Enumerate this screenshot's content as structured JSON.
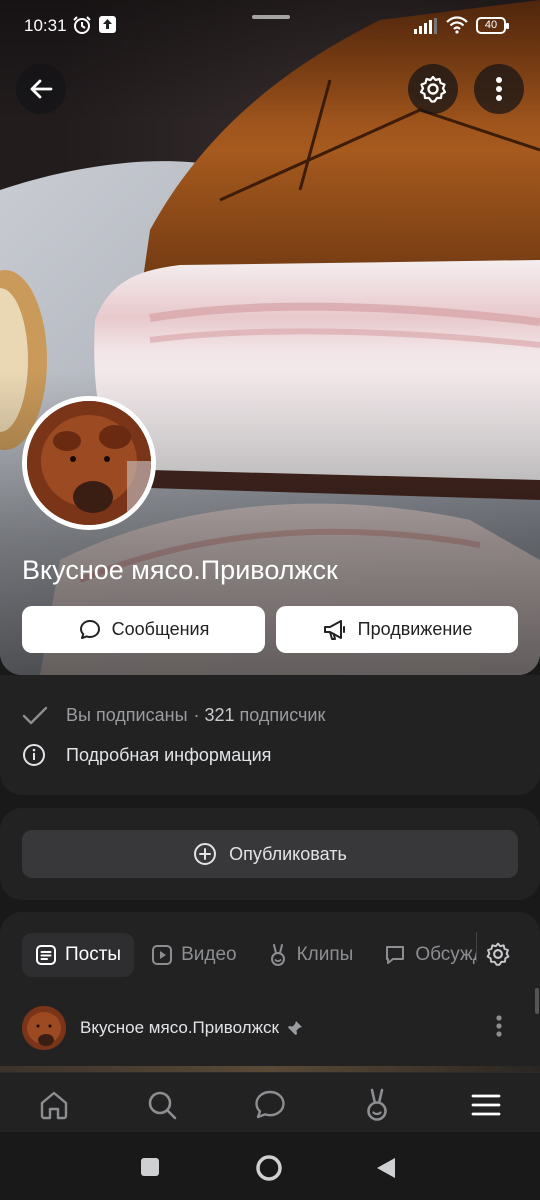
{
  "status_bar": {
    "time": "10:31",
    "battery": "40"
  },
  "group": {
    "name": "Вкусное мясо.Приволжск"
  },
  "cover_actions": {
    "messages_label": "Сообщения",
    "promotion_label": "Продвижение"
  },
  "info": {
    "subscribed_text": "Вы подписаны",
    "separator": "·",
    "subscriber_count": "321",
    "subscriber_word": "подписчик",
    "details_label": "Подробная информация"
  },
  "publish": {
    "label": "Опубликовать"
  },
  "tabs": [
    {
      "label": "Посты",
      "icon": "posts-icon",
      "active": true
    },
    {
      "label": "Видео",
      "icon": "video-icon",
      "active": false
    },
    {
      "label": "Клипы",
      "icon": "clips-icon",
      "active": false
    },
    {
      "label": "Обсуждения",
      "icon": "chat-icon",
      "active": false
    }
  ],
  "post": {
    "author": "Вкусное мясо.Приволжск",
    "pinned_icon": "pin-icon"
  },
  "bottom_nav": [
    {
      "name": "home",
      "icon": "home-icon"
    },
    {
      "name": "search",
      "icon": "search-icon"
    },
    {
      "name": "messenger",
      "icon": "chat-bubble-icon"
    },
    {
      "name": "clips",
      "icon": "clips-icon"
    },
    {
      "name": "menu",
      "icon": "menu-icon"
    }
  ],
  "colors": {
    "background": "#19191a",
    "card": "#222223",
    "button_dark": "#38383a",
    "text_primary": "#e1e3e6",
    "text_secondary": "#9a9c9f"
  }
}
